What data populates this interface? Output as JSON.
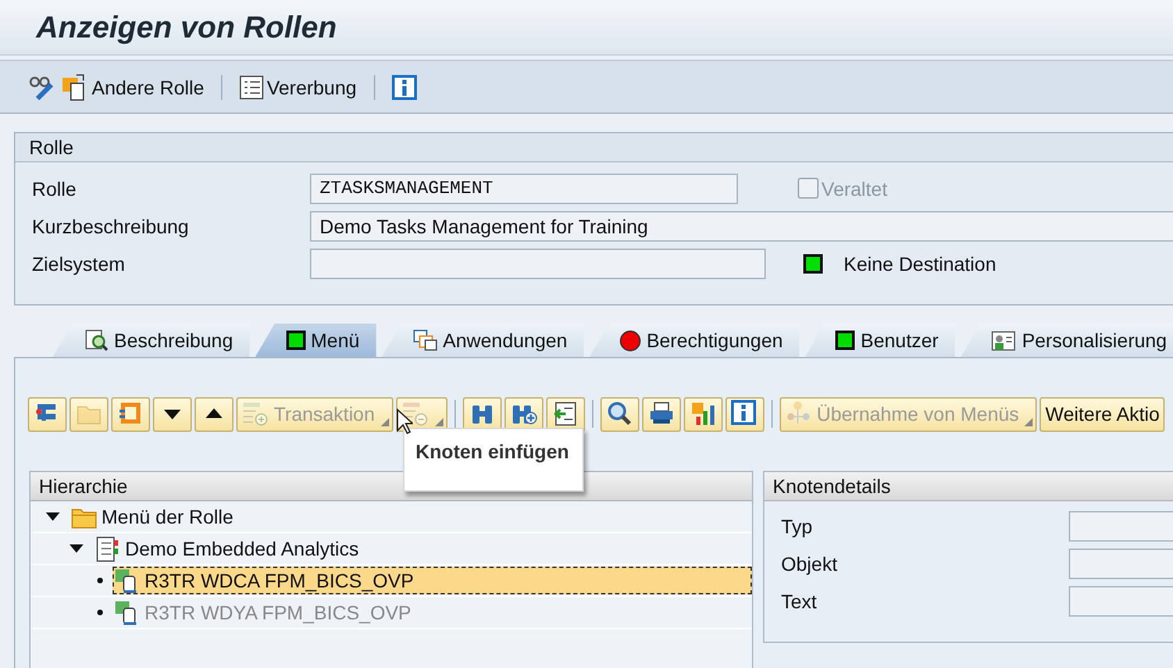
{
  "title": "Anzeigen von Rollen",
  "toolbar": [
    {
      "kind": "icon"
    },
    {
      "kind": "labeled",
      "label": "Andere Rolle"
    },
    {
      "kind": "separator"
    },
    {
      "kind": "labeled",
      "label": "Vererbung"
    },
    {
      "kind": "separator"
    },
    {
      "kind": "icon"
    }
  ],
  "role_group": {
    "title": "Rolle",
    "rows": [
      {
        "label": "Rolle",
        "value": "ZTASKSMANAGEMENT",
        "kind": "code",
        "checkbox": {
          "label": "Veraltet",
          "checked": false,
          "disabled": true
        }
      },
      {
        "label": "Kurzbeschreibung",
        "value": "Demo Tasks Management for Training",
        "kind": "text"
      },
      {
        "label": "Zielsystem",
        "kind": "text",
        "status": {
          "label": "Keine Destination",
          "color": "#00e000"
        }
      }
    ]
  },
  "tabs": [
    {
      "label": "Beschreibung",
      "selected": false,
      "kind": "icon"
    },
    {
      "label": "Menü",
      "selected": true,
      "kind": "square",
      "color": "#00dd00"
    },
    {
      "label": "Anwendungen",
      "selected": false,
      "kind": "icon"
    },
    {
      "label": "Berechtigungen",
      "selected": false,
      "kind": "light",
      "color": "#ee0000"
    },
    {
      "label": "Benutzer",
      "selected": false,
      "kind": "square",
      "color": "#00dd00"
    },
    {
      "label": "Personalisierung",
      "selected": false,
      "kind": "icon"
    }
  ],
  "menu_toolbar": [
    {
      "kind": "icon",
      "disabled": false
    },
    {
      "kind": "icon",
      "disabled": true
    },
    {
      "kind": "icon",
      "disabled": false
    },
    {
      "kind": "icon",
      "disabled": false
    },
    {
      "kind": "icon",
      "disabled": false
    },
    {
      "kind": "menu",
      "label": "Transaktion",
      "disabled": true
    },
    {
      "kind": "iconmenu",
      "disabled": true
    },
    {
      "kind": "separator"
    },
    {
      "kind": "icon",
      "disabled": false
    },
    {
      "kind": "icon",
      "disabled": false
    },
    {
      "kind": "icon",
      "disabled": false
    },
    {
      "kind": "separator"
    },
    {
      "kind": "icon",
      "disabled": false
    },
    {
      "kind": "icon",
      "disabled": false
    },
    {
      "kind": "icon",
      "disabled": false
    },
    {
      "kind": "icon",
      "disabled": false
    },
    {
      "kind": "separator"
    },
    {
      "kind": "menu",
      "label": "Übernahme von Menüs",
      "disabled": true
    },
    {
      "kind": "menu",
      "label": "Weitere Aktio",
      "disabled": false
    }
  ],
  "tooltip": "Knoten einfügen",
  "hierarchy": {
    "title": "Hierarchie",
    "nodes": [
      {
        "label": "Menü der Rolle",
        "kind": "folder",
        "expanded": true,
        "selected": false,
        "disabled": false,
        "children": [
          {
            "label": "Demo Embedded Analytics",
            "kind": "menu",
            "expanded": true,
            "selected": false,
            "disabled": false,
            "children": [
              {
                "label": "R3TR WDCA FPM_BICS_OVP",
                "kind": "item",
                "selected": true,
                "disabled": false
              },
              {
                "label": "R3TR WDYA FPM_BICS_OVP",
                "kind": "item",
                "selected": false,
                "disabled": true
              }
            ]
          }
        ]
      }
    ]
  },
  "details": {
    "title": "Knotendetails",
    "fields": [
      {
        "label": "Typ"
      },
      {
        "label": "Objekt"
      },
      {
        "label": "Text"
      }
    ]
  }
}
